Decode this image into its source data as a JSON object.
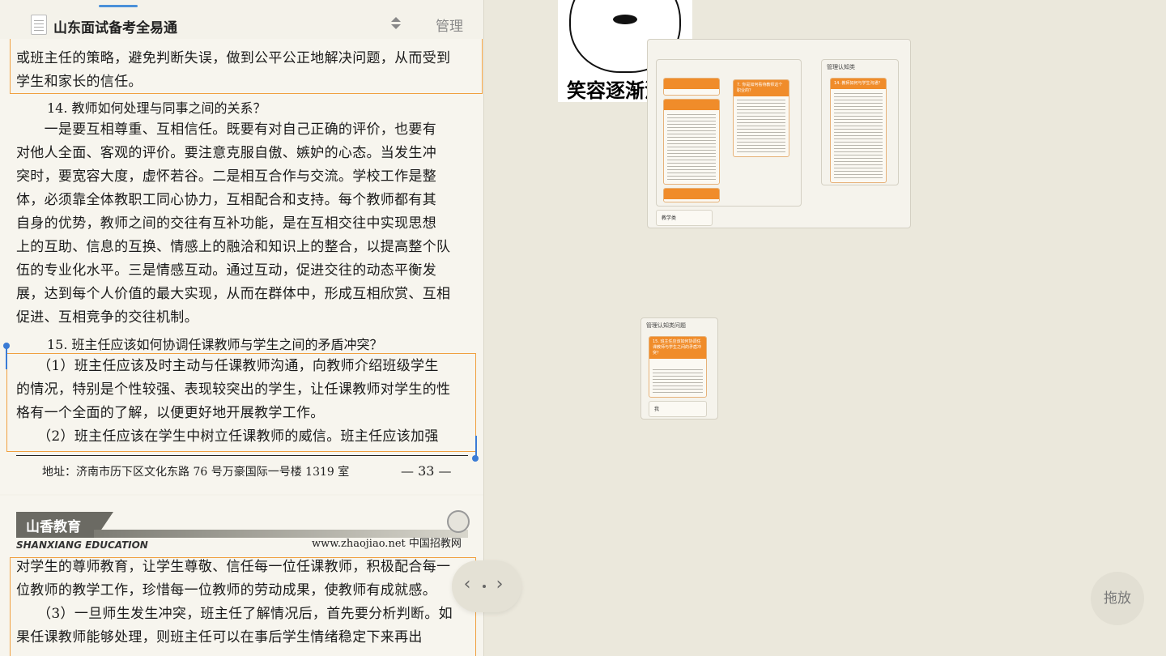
{
  "doc": {
    "title": "山东面试备考全易通",
    "manage_label": "管理",
    "page1": {
      "intro_lines": [
        "或班主任的策略，避免判断失误，做到公平公正地解决问题，从而受到",
        "学生和家长的信任。"
      ],
      "q14": "14. 教师如何处理与同事之间的关系？",
      "a14_lines": [
        "　　一是要互相尊重、互相信任。既要有对自己正确的评价，也要有",
        "对他人全面、客观的评价。要注意克服自傲、嫉妒的心态。当发生冲",
        "突时，要宽容大度，虚怀若谷。二是相互合作与交流。学校工作是整",
        "体，必须靠全体教职工同心协力，互相配合和支持。每个教师都有其",
        "自身的优势，教师之间的交往有互补功能，是在互相交往中实现思想",
        "上的互助、信息的互换、情感上的融洽和知识上的整合，以提高整个队",
        "伍的专业化水平。三是情感互动。通过互动，促进交往的动态平衡发",
        "展，达到每个人价值的最大实现，从而在群体中，形成互相欣赏、互相",
        "促进、互相竞争的交往机制。"
      ],
      "q15": "15. 班主任应该如何协调任课教师与学生之间的矛盾冲突？",
      "a15_lines": [
        "　　（1）班主任应该及时主动与任课教师沟通，向教师介绍班级学生",
        "的情况，特别是个性较强、表现较突出的学生，让任课教师对学生的性",
        "格有一个全面的了解，以便更好地开展教学工作。",
        "　　（2）班主任应该在学生中树立任课教师的威信。班主任应该加强"
      ],
      "footer_address": "地址：济南市历下区文化东路 76 号万豪国际一号楼 1319 室",
      "page_number": "— 33 —"
    },
    "page2": {
      "brand_logo": "山香教育",
      "brand_en": "SHANXIANG EDUCATION",
      "brand_url": "www.zhaojiao.net 中国招教网",
      "lines": [
        "对学生的尊师教育，让学生尊敬、信任每一位任课教师，积极配合每一",
        "位教师的教学工作，珍惜每一位教师的劳动成果，使教师有成就感。",
        "　　（3）一旦师生发生冲突，班主任了解情况后，首先要分析判断。如",
        "果任课教师能够处理，则班主任可以在事后学生情绪稳定下来再出"
      ]
    }
  },
  "canvas": {
    "meme_caption": "笑容逐渐消失",
    "frame_main_label": "",
    "frame_right_label": "管理认知类",
    "frame_bottom_label": "管理认知类问题",
    "cards": {
      "c1": "7. 你是如何看待教师这个职业的？",
      "c2": "14. 教师如何与学生沟通？",
      "c3": "15. 班主任应该如何协调任课教师与学生之间的矛盾冲突？"
    },
    "note_left": "教学类",
    "note_bottom": "我",
    "drag_label": "拖放",
    "accent_color": "#f08c2a"
  }
}
